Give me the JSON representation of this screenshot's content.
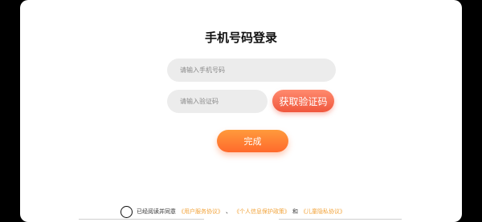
{
  "login": {
    "title": "手机号码登录",
    "phone_placeholder": "请输入手机号码",
    "code_placeholder": "请输入验证码",
    "get_code_label": "获取验证码",
    "submit_label": "完成"
  },
  "agreement": {
    "prefix": "已经阅读并同意",
    "links": [
      "《用户服务协议》",
      "《个人信息保护政策》",
      "《儿童隐私协议》"
    ],
    "separator": "、",
    "and": "和"
  },
  "colors": {
    "get_code_button": "#f0573d",
    "submit_button": "#ff6a2c",
    "link": "#f2a33a",
    "input_bg": "#ececec"
  }
}
